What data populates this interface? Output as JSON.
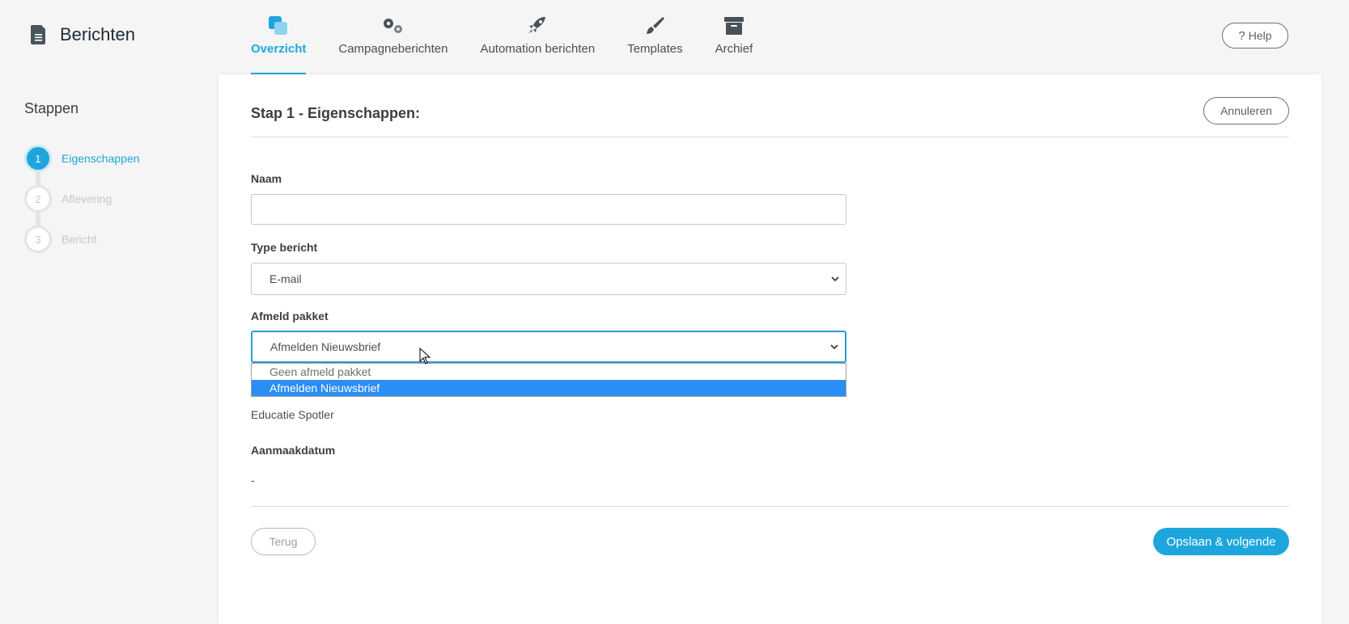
{
  "header": {
    "title": "Berichten",
    "nav": [
      {
        "label": "Overzicht",
        "icon": "overview-icon",
        "active": true
      },
      {
        "label": "Campagneberichten",
        "icon": "gears-icon",
        "active": false
      },
      {
        "label": "Automation berichten",
        "icon": "rocket-icon",
        "active": false
      },
      {
        "label": "Templates",
        "icon": "brush-icon",
        "active": false
      },
      {
        "label": "Archief",
        "icon": "archive-icon",
        "active": false
      }
    ],
    "help_label": "Help"
  },
  "sidebar": {
    "heading": "Stappen",
    "steps": [
      {
        "number": "1",
        "label": "Eigenschappen",
        "active": true
      },
      {
        "number": "2",
        "label": "Aflevering",
        "active": false
      },
      {
        "number": "3",
        "label": "Bericht",
        "active": false
      }
    ]
  },
  "form": {
    "title": "Stap 1 - Eigenschappen:",
    "cancel_label": "Annuleren",
    "name_label": "Naam",
    "name_value": "",
    "type_label": "Type bericht",
    "type_value": "E-mail",
    "unsubscribe_label": "Afmeld pakket",
    "unsubscribe_value": "Afmelden Nieuwsbrief",
    "unsubscribe_options": [
      "Geen afmeld pakket",
      "Afmelden Nieuwsbrief"
    ],
    "unsubscribe_selected_index": 1,
    "account_value": "Educatie Spotler",
    "created_label": "Aanmaakdatum",
    "created_value": "-",
    "back_label": "Terug",
    "save_label": "Opslaan & volgende"
  },
  "colors": {
    "accent": "#1ea6dc",
    "option_highlight": "#2a8ef4",
    "background": "#f5f5f5"
  }
}
